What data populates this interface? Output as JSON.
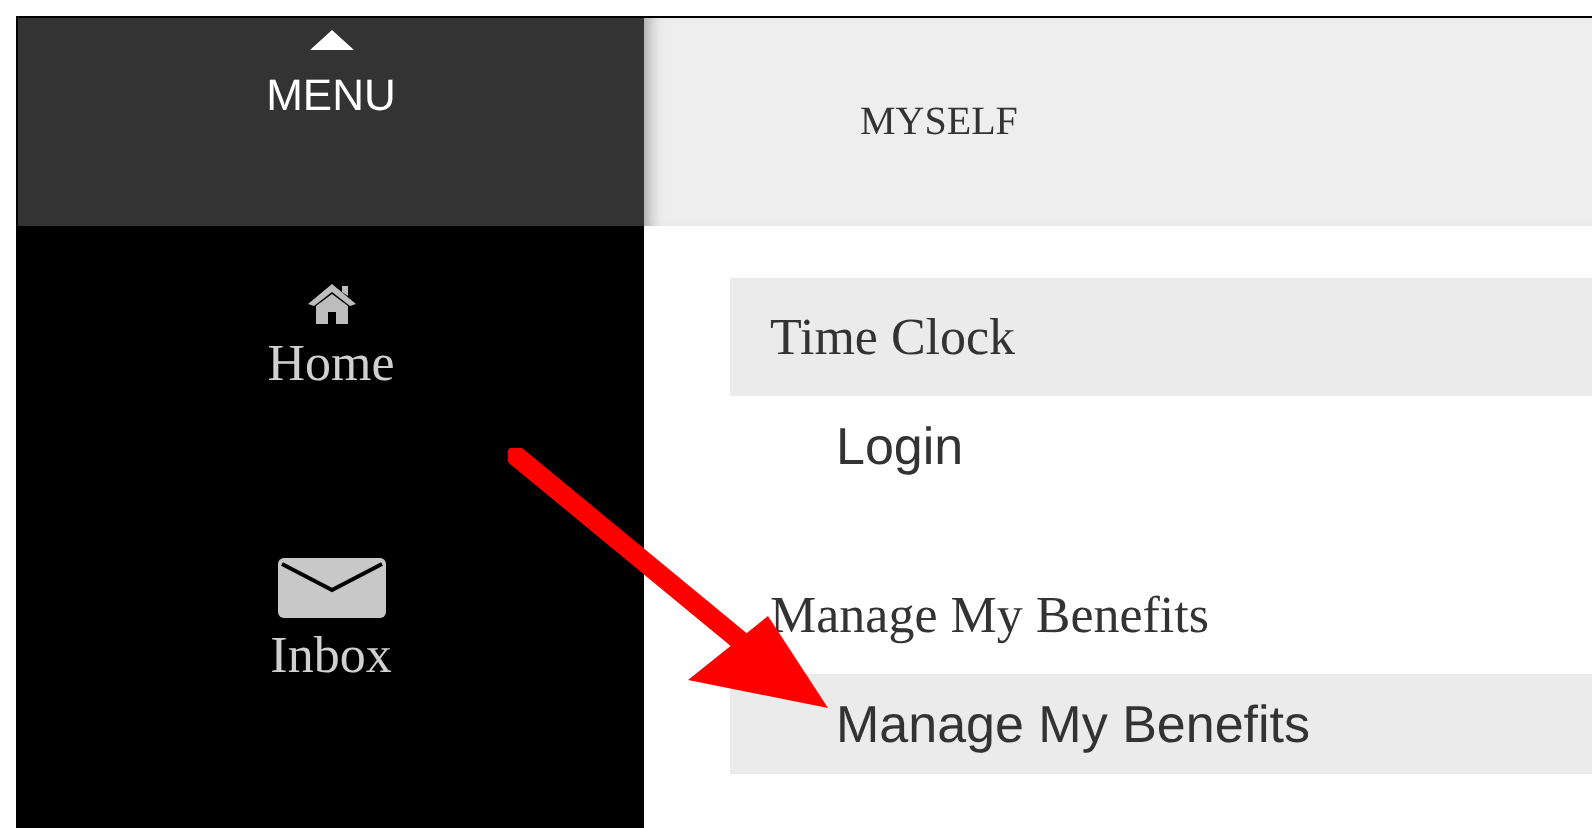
{
  "menu": {
    "label": "MENU"
  },
  "sidebar": {
    "items": [
      {
        "kind": "home",
        "label": "Home"
      },
      {
        "kind": "inbox",
        "label": "Inbox"
      }
    ]
  },
  "header": {
    "title": "MYSELF"
  },
  "sections": [
    {
      "title": "Time Clock",
      "highlighted": true,
      "items": [
        {
          "label": "Login",
          "highlighted": false
        }
      ]
    },
    {
      "title": "Manage My Benefits",
      "highlighted": false,
      "items": [
        {
          "label": "Manage My Benefits",
          "highlighted": true
        }
      ]
    }
  ]
}
